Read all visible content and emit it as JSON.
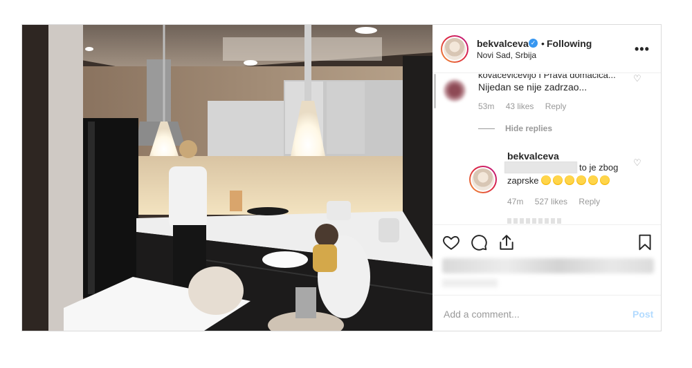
{
  "post": {
    "header": {
      "username": "bekvalceva",
      "separator": "•",
      "follow_status": "Following",
      "location": "Novi Sad, Srbija",
      "more_icon": "more-horizontal-icon",
      "verified_icon": "verified-badge-icon"
    },
    "comments": [
      {
        "text_cut": "kovacevicevljo I Prava domacica...",
        "text": "Nijedan se nije zadrzao...",
        "time": "53m",
        "likes": "43 likes",
        "reply_label": "Reply",
        "hide_replies": "Hide replies",
        "replies": [
          {
            "username": "bekvalceva",
            "text_line1": "to je zbog",
            "text_line2": "zaprske",
            "emoji_count": 6,
            "time": "47m",
            "likes": "527 likes",
            "reply_label": "Reply"
          }
        ]
      }
    ],
    "actions": {
      "like_icon": "heart-icon",
      "comment_icon": "comment-icon",
      "share_icon": "share-icon",
      "save_icon": "bookmark-icon"
    },
    "add_comment": {
      "placeholder": "Add a comment...",
      "post_label": "Post"
    },
    "colors": {
      "verified": "#3897f0",
      "post_button_disabled": "#b3dbff",
      "meta_text": "#999999"
    }
  }
}
